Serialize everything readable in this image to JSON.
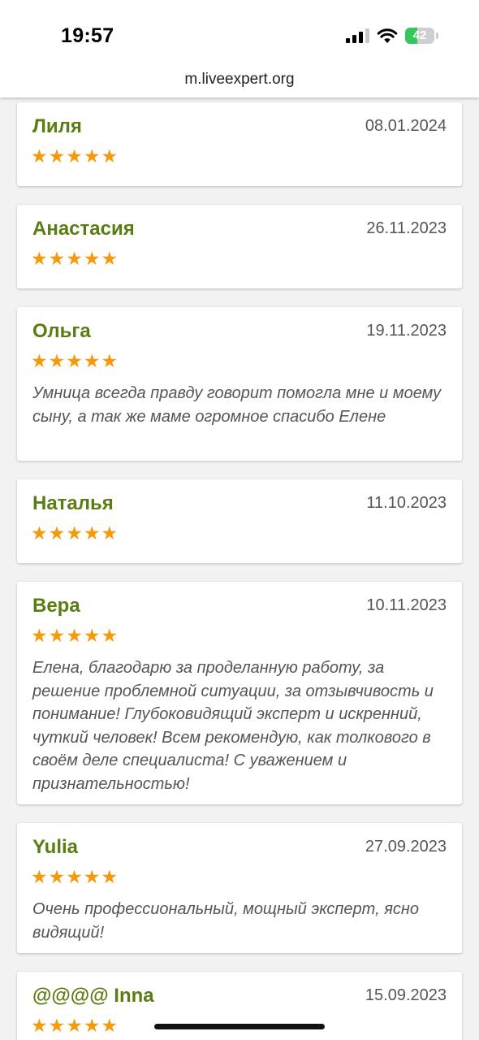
{
  "status_bar": {
    "time": "19:57",
    "battery": "42",
    "battery_level": 0.42
  },
  "url": "m.liveexpert.org",
  "reviews": [
    {
      "name": "Лиля",
      "date": "08.01.2024",
      "stars": "★★★★★",
      "rating": 5,
      "text": ""
    },
    {
      "name": "Анастасия",
      "date": "26.11.2023",
      "stars": "★★★★★",
      "rating": 5,
      "text": ""
    },
    {
      "name": "Ольга",
      "date": "19.11.2023",
      "stars": "★★★★★",
      "rating": 5,
      "text": "Умница всегда правду говорит помогла мне и моему сыну, а так же маме огромное спасибо Елене"
    },
    {
      "name": "Наталья",
      "date": "11.10.2023",
      "stars": "★★★★★",
      "rating": 5,
      "text": ""
    },
    {
      "name": "Вера",
      "date": "10.11.2023",
      "stars": "★★★★★",
      "rating": 5,
      "text": "Елена, благодарю за проделанную работу, за решение проблемной ситуации, за отзывчивость и понимание! Глубоковидящий эксперт и искренний, чуткий человек! Всем рекомендую, как толкового в своём деле специалиста! С уважением и признательностью!"
    },
    {
      "name": "Yulia",
      "date": "27.09.2023",
      "stars": "★★★★★",
      "rating": 5,
      "text": "Очень профессиональный, мощный эксперт, ясно видящий!"
    },
    {
      "name": "@@@@ Inna",
      "date": "15.09.2023",
      "stars": "★★★★★",
      "rating": 5,
      "text": ""
    }
  ]
}
